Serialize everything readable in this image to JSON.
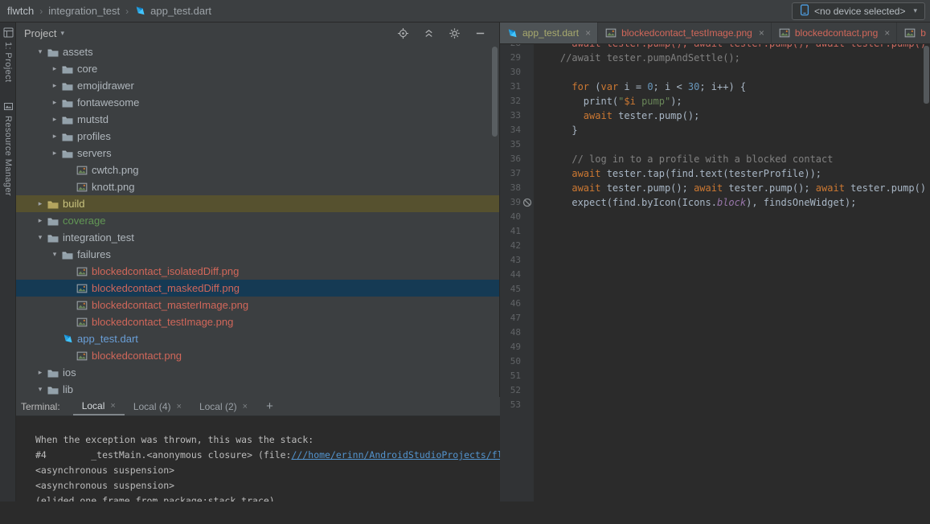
{
  "header": {
    "breadcrumbs": [
      "flwtch",
      "integration_test",
      "app_test.dart"
    ],
    "separator": "›",
    "device": {
      "label": "<no device selected>",
      "caret": "▾"
    }
  },
  "tool_strip": {
    "items": [
      {
        "label": "1: Project",
        "icon": "project-stripe"
      },
      {
        "label": "Resource Manager",
        "icon": "resource-stripe"
      }
    ]
  },
  "project_panel": {
    "title": "Project",
    "caret": "▾",
    "header_icons": [
      "locate",
      "collapse-all",
      "settings",
      "hide"
    ],
    "tree": [
      {
        "label": "assets",
        "indent": 1,
        "arrow": "open",
        "icon": "folder",
        "color": ""
      },
      {
        "label": "core",
        "indent": 2,
        "arrow": "closed",
        "icon": "folder",
        "color": ""
      },
      {
        "label": "emojidrawer",
        "indent": 2,
        "arrow": "closed",
        "icon": "folder",
        "color": ""
      },
      {
        "label": "fontawesome",
        "indent": 2,
        "arrow": "closed",
        "icon": "folder",
        "color": ""
      },
      {
        "label": "mutstd",
        "indent": 2,
        "arrow": "closed",
        "icon": "folder",
        "color": ""
      },
      {
        "label": "profiles",
        "indent": 2,
        "arrow": "closed",
        "icon": "folder",
        "color": ""
      },
      {
        "label": "servers",
        "indent": 2,
        "arrow": "closed",
        "icon": "folder",
        "color": ""
      },
      {
        "label": "cwtch.png",
        "indent": 3,
        "arrow": "none",
        "icon": "image",
        "color": ""
      },
      {
        "label": "knott.png",
        "indent": 3,
        "arrow": "none",
        "icon": "image",
        "color": ""
      },
      {
        "label": "build",
        "indent": 1,
        "arrow": "closed",
        "icon": "folder-build",
        "color": "t-excluded",
        "row": "row-build"
      },
      {
        "label": "coverage",
        "indent": 1,
        "arrow": "closed",
        "icon": "folder",
        "color": "t-green"
      },
      {
        "label": "integration_test",
        "indent": 1,
        "arrow": "open",
        "icon": "folder",
        "color": ""
      },
      {
        "label": "failures",
        "indent": 2,
        "arrow": "open",
        "icon": "folder",
        "color": ""
      },
      {
        "label": "blockedcontact_isolatedDiff.png",
        "indent": 3,
        "arrow": "none",
        "icon": "image",
        "color": "t-red"
      },
      {
        "label": "blockedcontact_maskedDiff.png",
        "indent": 3,
        "arrow": "none",
        "icon": "image",
        "color": "t-red",
        "row": "row-selected"
      },
      {
        "label": "blockedcontact_masterImage.png",
        "indent": 3,
        "arrow": "none",
        "icon": "image",
        "color": "t-red"
      },
      {
        "label": "blockedcontact_testImage.png",
        "indent": 3,
        "arrow": "none",
        "icon": "image",
        "color": "t-red"
      },
      {
        "label": "app_test.dart",
        "indent": 2,
        "arrow": "none",
        "icon": "dart",
        "color": "t-blue"
      },
      {
        "label": "blockedcontact.png",
        "indent": 3,
        "arrow": "none",
        "icon": "image",
        "color": "t-red"
      },
      {
        "label": "ios",
        "indent": 1,
        "arrow": "closed",
        "icon": "folder",
        "color": ""
      },
      {
        "label": "lib",
        "indent": 1,
        "arrow": "open",
        "icon": "folder",
        "color": ""
      }
    ]
  },
  "editor": {
    "tabs": [
      {
        "label": "app_test.dart",
        "icon": "dart",
        "state": "active",
        "label_class": "tab-green",
        "close": "×"
      },
      {
        "label": "blockedcontact_testImage.png",
        "icon": "image",
        "state": "inactive",
        "label_class": "tab-red",
        "close": "×"
      },
      {
        "label": "blockedcontact.png",
        "icon": "image",
        "state": "inactive",
        "label_class": "tab-red",
        "close": "×"
      },
      {
        "label": "b",
        "icon": "image",
        "state": "inactive",
        "label_class": "tab-red",
        "close": ""
      }
    ],
    "lines": [
      {
        "num": "28",
        "indent": 6,
        "tokens": [
          {
            "c": "redln",
            "t": "await tester.pump(); await tester.pump(); await tester.pump();"
          }
        ]
      },
      {
        "num": "29",
        "indent": 4,
        "tokens": [
          {
            "c": "cmt",
            "t": "//await tester.pumpAndSettle();"
          }
        ]
      },
      {
        "num": "30",
        "indent": 0,
        "tokens": []
      },
      {
        "num": "31",
        "indent": 6,
        "tokens": [
          {
            "c": "kw",
            "t": "for"
          },
          {
            "c": "pln",
            "t": " ("
          },
          {
            "c": "kw",
            "t": "var"
          },
          {
            "c": "pln",
            "t": " i = "
          },
          {
            "c": "num",
            "t": "0"
          },
          {
            "c": "pln",
            "t": "; i < "
          },
          {
            "c": "num",
            "t": "30"
          },
          {
            "c": "pln",
            "t": "; i++) {"
          }
        ]
      },
      {
        "num": "32",
        "indent": 8,
        "tokens": [
          {
            "c": "pln",
            "t": "print("
          },
          {
            "c": "str",
            "t": "\""
          },
          {
            "c": "itp",
            "t": "$i"
          },
          {
            "c": "str",
            "t": " pump\""
          },
          {
            "c": "pln",
            "t": ");"
          }
        ]
      },
      {
        "num": "33",
        "indent": 8,
        "tokens": [
          {
            "c": "kw",
            "t": "await"
          },
          {
            "c": "pln",
            "t": " tester.pump();"
          }
        ]
      },
      {
        "num": "34",
        "indent": 6,
        "tokens": [
          {
            "c": "pln",
            "t": "}"
          }
        ]
      },
      {
        "num": "35",
        "indent": 0,
        "tokens": []
      },
      {
        "num": "36",
        "indent": 6,
        "tokens": [
          {
            "c": "cmt",
            "t": "// log in to a profile with a blocked contact"
          }
        ]
      },
      {
        "num": "37",
        "indent": 6,
        "tokens": [
          {
            "c": "kw",
            "t": "await"
          },
          {
            "c": "pln",
            "t": " tester.tap(find.text(testerProfile));"
          }
        ]
      },
      {
        "num": "38",
        "indent": 6,
        "tokens": [
          {
            "c": "kw",
            "t": "await"
          },
          {
            "c": "pln",
            "t": " tester.pump(); "
          },
          {
            "c": "kw",
            "t": "await"
          },
          {
            "c": "pln",
            "t": " tester.pump(); "
          },
          {
            "c": "kw",
            "t": "await"
          },
          {
            "c": "pln",
            "t": " tester.pump();"
          }
        ]
      },
      {
        "num": "39",
        "indent": 6,
        "gutter": "banned",
        "tokens": [
          {
            "c": "pln",
            "t": "expect(find.byIcon(Icons."
          },
          {
            "c": "fld",
            "t": "block"
          },
          {
            "c": "pln",
            "t": "), findsOneWidget);"
          }
        ]
      },
      {
        "num": "40",
        "indent": 0,
        "tokens": []
      }
    ],
    "extra_line_numbers": {
      "from": 41,
      "to": 53
    }
  },
  "terminal": {
    "title": "Terminal:",
    "tabs": [
      {
        "label": "Local",
        "active": true,
        "close": "×"
      },
      {
        "label": "Local (4)",
        "active": false,
        "close": "×"
      },
      {
        "label": "Local (2)",
        "active": false,
        "close": "×"
      }
    ],
    "new_tab": "+",
    "lines": [
      [
        {
          "t": "When the exception was thrown, this was the stack:"
        }
      ],
      [
        {
          "t": "#4        _testMain.<anonymous closure> (file:"
        },
        {
          "t": "///home/erinn/AndroidStudioProjects/flwtch/",
          "link": true
        }
      ],
      [
        {
          "t": "<asynchronous suspension>"
        }
      ],
      [
        {
          "t": "<asynchronous suspension>"
        }
      ],
      [
        {
          "t": "(elided one frame from package:stack_trace)"
        }
      ]
    ]
  },
  "preview": {
    "toolbar_icons": [
      "image",
      "pin"
    ]
  },
  "colors": {
    "selection_row": "#153a54",
    "excluded_row": "#56512f",
    "vcs_red": "#d1675a",
    "vcs_blue": "#6a9fd8",
    "test_green": "#629755",
    "keyword_orange": "#cc7832",
    "string_green": "#6a8759",
    "number_blue": "#6897bb"
  }
}
